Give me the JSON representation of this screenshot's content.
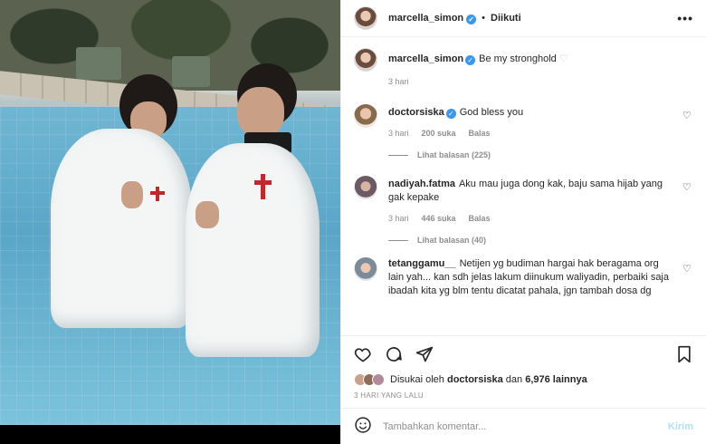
{
  "header": {
    "username": "marcella_simon",
    "follow_status": "Diikuti",
    "more_glyph": "•••"
  },
  "caption": {
    "username": "marcella_simon",
    "text": "Be my stronghold",
    "time": "3 hari"
  },
  "comments": [
    {
      "username": "doctorsiska",
      "verified": true,
      "text": "God bless you",
      "time": "3 hari",
      "likes": "200 suka",
      "reply": "Balas",
      "view_replies": "Lihat balasan (225)"
    },
    {
      "username": "nadiyah.fatma",
      "text": "Aku mau juga dong kak, baju sama hijab yang gak kepake",
      "time": "3 hari",
      "likes": "446 suka",
      "reply": "Balas",
      "view_replies": "Lihat balasan (40)"
    },
    {
      "username": "tetanggamu__",
      "text": "Netijen yg budiman hargai hak beragama org lain yah... kan sdh jelas lakum diinukum waliyadin, perbaiki saja ibadah kita yg blm tentu dicatat pahala, jgn tambah dosa dg"
    }
  ],
  "liked_by": {
    "prefix": "Disukai oleh",
    "user": "doctorsiska",
    "middle": "dan",
    "count": "6,976 lainnya"
  },
  "post_date": "3 HARI YANG LALU",
  "add_comment": {
    "placeholder": "Tambahkan komentar...",
    "send_label": "Kirim"
  },
  "icons": {
    "heart": "heart-icon",
    "comment": "comment-icon",
    "share": "paper-plane-icon",
    "save": "bookmark-icon",
    "emoji": "emoji-icon"
  },
  "colors": {
    "verified": "#3897f0",
    "send_disabled": "#b2dffc",
    "muted": "#8e8e8e"
  }
}
